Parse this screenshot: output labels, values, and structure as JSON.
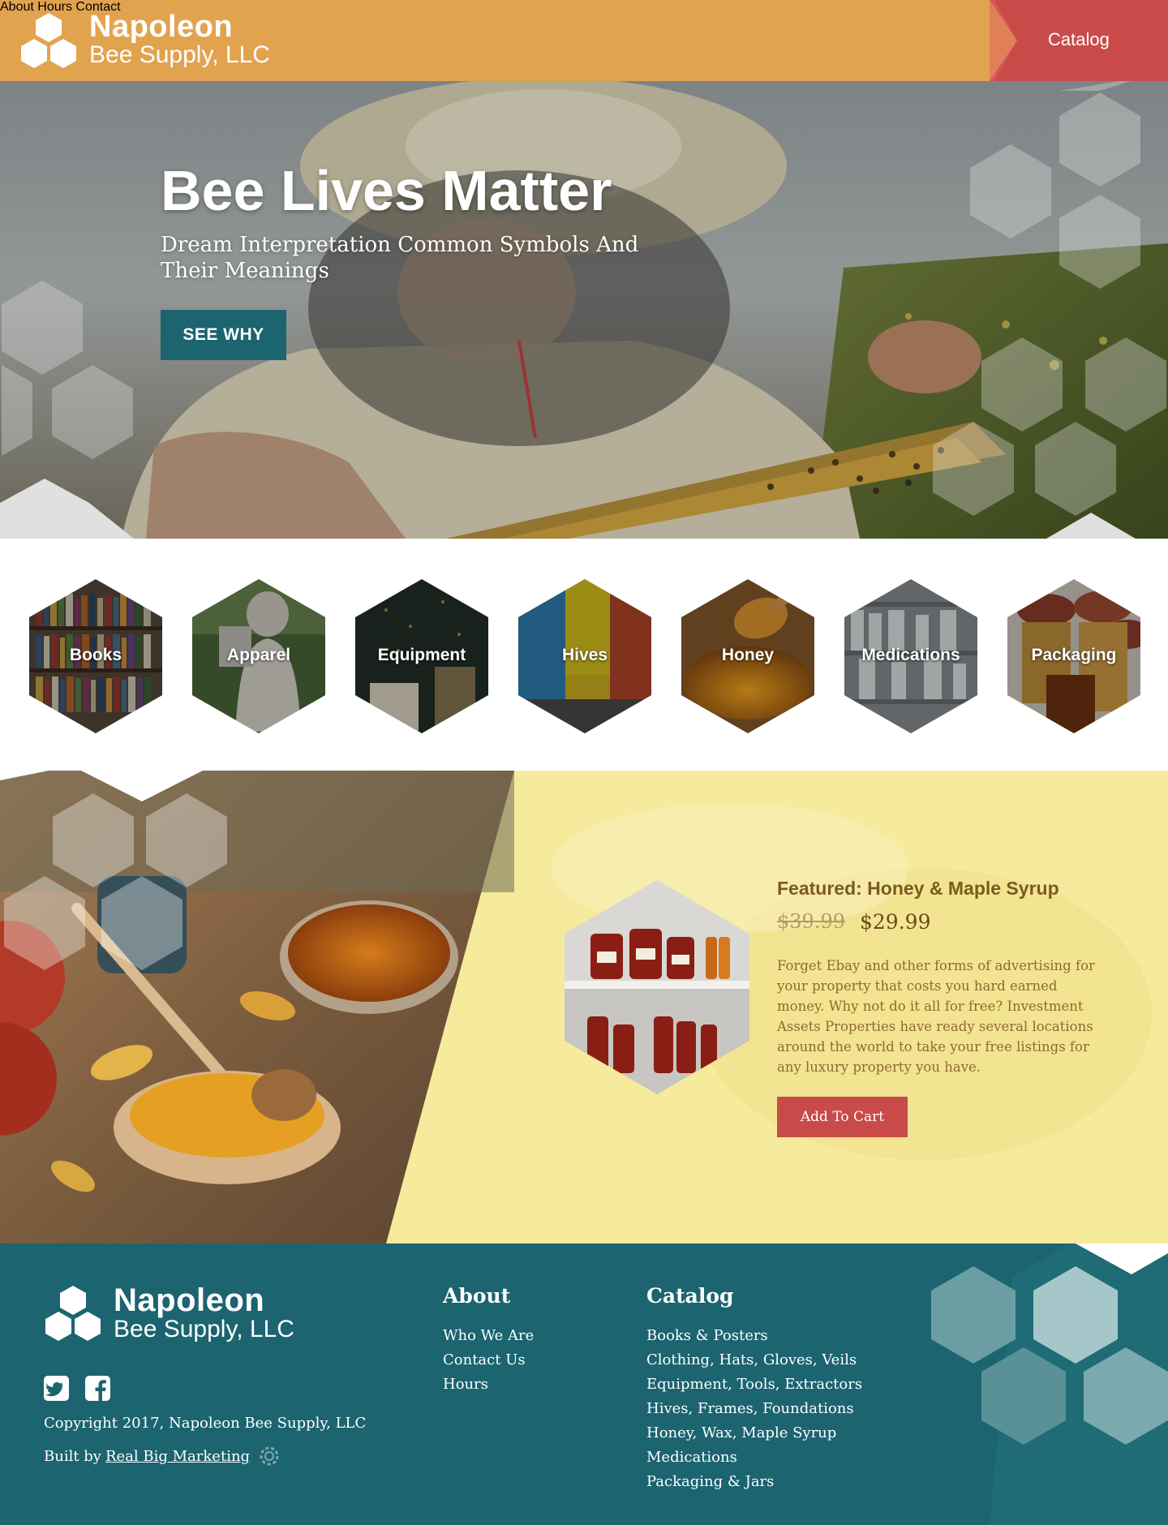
{
  "header": {
    "logo_name": "Napoleon",
    "logo_sub": "Bee Supply, LLC",
    "nav": [
      {
        "label": "About"
      },
      {
        "label": "Hours"
      },
      {
        "label": "Contact"
      }
    ],
    "catalog_label": "Catalog",
    "colors": {
      "bar": "#e2a34f",
      "catalog": "#c94b49"
    }
  },
  "hero": {
    "title": "Bee Lives Matter",
    "subtitle": "Dream Interpretation Common Symbols And Their Meanings",
    "button_label": "SEE WHY",
    "button_color": "#1b6470"
  },
  "categories": [
    {
      "label": "Books",
      "icon": "books-image"
    },
    {
      "label": "Apparel",
      "icon": "apparel-image"
    },
    {
      "label": "Equipment",
      "icon": "equipment-image"
    },
    {
      "label": "Hives",
      "icon": "hives-image"
    },
    {
      "label": "Honey",
      "icon": "honey-image"
    },
    {
      "label": "Medications",
      "icon": "medications-image"
    },
    {
      "label": "Packaging",
      "icon": "packaging-image"
    }
  ],
  "featured": {
    "title": "Featured: Honey & Maple Syrup",
    "old_price": "$39.99",
    "price": "$29.99",
    "description": "Forget Ebay and other forms of advertising for your property that costs you hard earned money. Why not do it all for free? Investment Assets Properties have ready several locations around the world to take your free listings for any luxury property you have.",
    "button_label": "Add To Cart"
  },
  "footer": {
    "logo_name": "Napoleon",
    "logo_sub": "Bee Supply, LLC",
    "social": [
      {
        "icon": "twitter-icon"
      },
      {
        "icon": "facebook-icon"
      }
    ],
    "copyright": "Copyright 2017, Napoleon Bee Supply, LLC",
    "built_by_prefix": "Built by",
    "built_by_link": "Real Big Marketing",
    "about": {
      "heading": "About",
      "links": [
        "Who We Are",
        "Contact Us",
        "Hours"
      ]
    },
    "catalog": {
      "heading": "Catalog",
      "links": [
        "Books & Posters",
        "Clothing, Hats, Gloves, Veils",
        "Equipment, Tools, Extractors",
        "Hives, Frames, Foundations",
        "Honey, Wax, Maple Syrup",
        "Medications",
        "Packaging & Jars"
      ]
    },
    "color": "#1b6470"
  }
}
